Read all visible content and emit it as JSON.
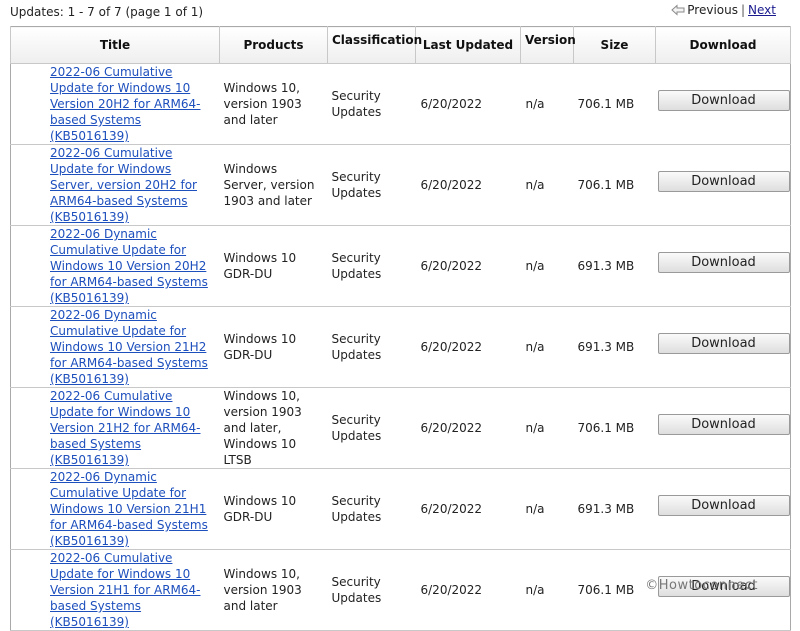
{
  "header": {
    "summary": "Updates: 1 - 7 of 7 (page 1 of 1)",
    "previous_label": "Previous",
    "separator": "|",
    "next_label": "Next",
    "previous_icon": "arrow-left-icon"
  },
  "columns": {
    "title": "Title",
    "products": "Products",
    "classification": "Classification",
    "last_updated": "Last Updated",
    "version": "Version",
    "size": "Size",
    "download": "Download"
  },
  "rows": [
    {
      "title": "2022-06 Cumulative Update for Windows 10 Version 20H2 for ARM64-based Systems (KB5016139)",
      "products": "Windows 10, version 1903 and later",
      "classification": "Security Updates",
      "last_updated": "6/20/2022",
      "version": "n/a",
      "size": "706.1 MB",
      "download": "Download"
    },
    {
      "title": "2022-06 Cumulative Update for Windows Server, version 20H2 for ARM64-based Systems (KB5016139)",
      "products": "Windows Server, version 1903 and later",
      "classification": "Security Updates",
      "last_updated": "6/20/2022",
      "version": "n/a",
      "size": "706.1 MB",
      "download": "Download"
    },
    {
      "title": "2022-06 Dynamic Cumulative Update for Windows 10 Version 20H2 for ARM64-based Systems (KB5016139)",
      "products": "Windows 10 GDR-DU",
      "classification": "Security Updates",
      "last_updated": "6/20/2022",
      "version": "n/a",
      "size": "691.3 MB",
      "download": "Download"
    },
    {
      "title": "2022-06 Dynamic Cumulative Update for Windows 10 Version 21H2 for ARM64-based Systems (KB5016139)",
      "products": "Windows 10 GDR-DU",
      "classification": "Security Updates",
      "last_updated": "6/20/2022",
      "version": "n/a",
      "size": "691.3 MB",
      "download": "Download"
    },
    {
      "title": "2022-06 Cumulative Update for Windows 10 Version 21H2 for ARM64-based Systems (KB5016139)",
      "products": "Windows 10, version 1903 and later, Windows 10 LTSB",
      "classification": "Security Updates",
      "last_updated": "6/20/2022",
      "version": "n/a",
      "size": "706.1 MB",
      "download": "Download"
    },
    {
      "title": "2022-06 Dynamic Cumulative Update for Windows 10 Version 21H1 for ARM64-based Systems (KB5016139)",
      "products": "Windows 10 GDR-DU",
      "classification": "Security Updates",
      "last_updated": "6/20/2022",
      "version": "n/a",
      "size": "691.3 MB",
      "download": "Download"
    },
    {
      "title": "2022-06 Cumulative Update for Windows 10 Version 21H1 for ARM64-based Systems (KB5016139)",
      "products": "Windows 10, version 1903 and later",
      "classification": "Security Updates",
      "last_updated": "6/20/2022",
      "version": "n/a",
      "size": "706.1 MB",
      "download": "Download"
    }
  ],
  "watermark": "©Howtoconnect",
  "colors": {
    "link": "#1d4fbd",
    "border": "#c8c8c8",
    "button_bg": "#e6e6e6"
  }
}
